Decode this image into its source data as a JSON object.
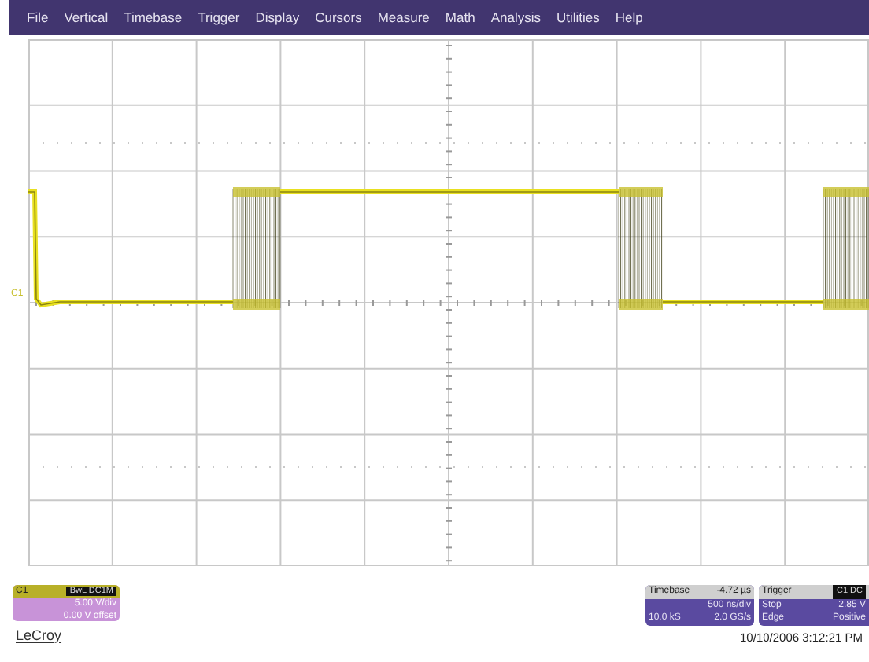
{
  "menu": [
    "File",
    "Vertical",
    "Timebase",
    "Trigger",
    "Display",
    "Cursors",
    "Measure",
    "Math",
    "Analysis",
    "Utilities",
    "Help"
  ],
  "plot": {
    "channel_marker": "C1"
  },
  "channel_panel": {
    "name": "C1",
    "badge": "BwL DC1M",
    "scale": "5.00 V/div",
    "offset": "0.00 V offset"
  },
  "timebase_panel": {
    "title": "Timebase",
    "delay": "-4.72 µs",
    "scale": "500 ns/div",
    "samples": "10.0 kS",
    "rate": "2.0 GS/s"
  },
  "trigger_panel": {
    "title": "Trigger",
    "badge": "C1 DC",
    "mode": "Stop",
    "level": "2.85 V",
    "type": "Edge",
    "slope": "Positive"
  },
  "logo": "LeCroy",
  "timestamp": "10/10/2006 3:12:21 PM"
}
